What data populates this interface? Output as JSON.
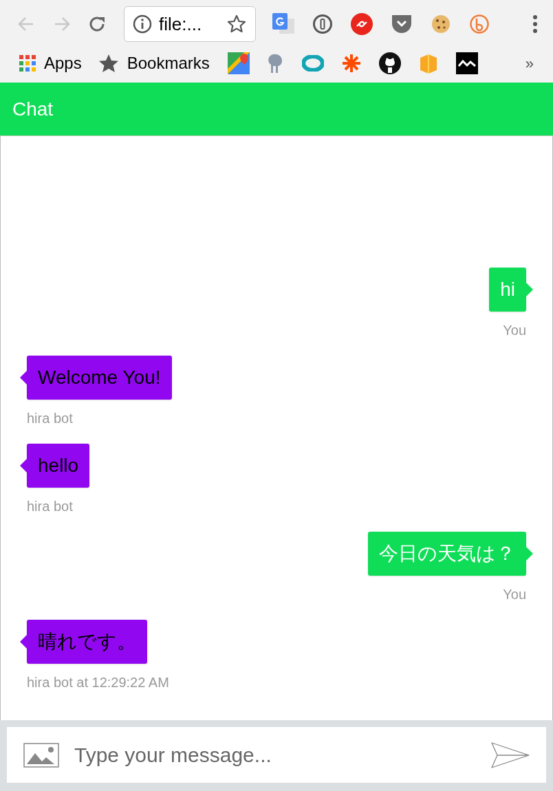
{
  "browser": {
    "address": "file:...",
    "bookmarks": [
      {
        "kind": "apps",
        "label": "Apps"
      },
      {
        "kind": "star",
        "label": "Bookmarks"
      }
    ],
    "overflow": "»"
  },
  "header": {
    "title": "Chat"
  },
  "messages": [
    {
      "kind": "outgoing",
      "text": "hi",
      "meta": "You"
    },
    {
      "kind": "incoming",
      "text": "Welcome You!",
      "meta": "hira bot"
    },
    {
      "kind": "incoming",
      "text": "hello",
      "meta": "hira bot"
    },
    {
      "kind": "outgoing",
      "text": "今日の天気は？",
      "meta": "You"
    },
    {
      "kind": "incoming",
      "text": "晴れです。",
      "meta": "hira bot at 12:29:22 AM"
    }
  ],
  "composer": {
    "placeholder": "Type your message..."
  }
}
